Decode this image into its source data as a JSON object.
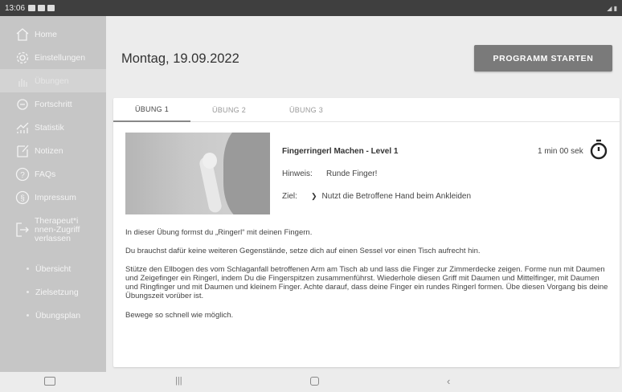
{
  "statusbar": {
    "time": "13:06"
  },
  "sidebar": {
    "items": [
      {
        "label": "Home",
        "icon": "home-icon"
      },
      {
        "label": "Einstellungen",
        "icon": "settings-icon"
      },
      {
        "label": "Übungen",
        "icon": "exercises-icon"
      },
      {
        "label": "Fortschritt",
        "icon": "progress-icon"
      },
      {
        "label": "Statistik",
        "icon": "statistics-icon"
      },
      {
        "label": "Notizen",
        "icon": "notes-icon"
      },
      {
        "label": "FAQs",
        "icon": "faq-icon"
      },
      {
        "label": "Impressum",
        "icon": "imprint-icon"
      },
      {
        "label": "Therapeut*i nnen-Zugriff verlassen",
        "icon": "exit-icon"
      }
    ],
    "subitems": [
      {
        "label": "Übersicht"
      },
      {
        "label": "Zielsetzung"
      },
      {
        "label": "Übungsplan"
      }
    ]
  },
  "header": {
    "date": "Montag, 19.09.2022",
    "start_label": "PROGRAMM STARTEN"
  },
  "tabs": [
    {
      "label": "ÜBUNG 1"
    },
    {
      "label": "ÜBUNG 2"
    },
    {
      "label": "ÜBUNG 3"
    }
  ],
  "exercise": {
    "title": "Fingerringerl Machen - Level 1",
    "duration": "1 min 00 sek",
    "hint_label": "Hinweis:",
    "hint": "Runde Finger!",
    "goal_label": "Ziel:",
    "goal": "Nutzt die Betroffene Hand beim Ankleiden",
    "paragraphs": [
      "In dieser Übung formst du „Ringerl“ mit deinen Fingern.",
      "Du brauchst dafür keine weiteren Gegenstände, setze dich auf einen Sessel vor einen Tisch aufrecht hin.",
      "Stütze den Ellbogen des vom Schlaganfall betroffenen Arm am Tisch ab und lass die Finger zur Zimmerdecke zeigen. Forme nun mit Daumen und Zeigefinger ein Ringerl, indem Du die Fingerspitzen zusammenführst. Wiederhole diesen Griff mit Daumen und Mittelfinger, mit Daumen und Ringfinger und mit Daumen und kleinem Finger. Achte darauf, dass deine Finger ein rundes Ringerl formen. Übe diesen Vorgang bis deine Übungszeit vorüber ist.",
      "Bewege so schnell wie möglich."
    ]
  }
}
